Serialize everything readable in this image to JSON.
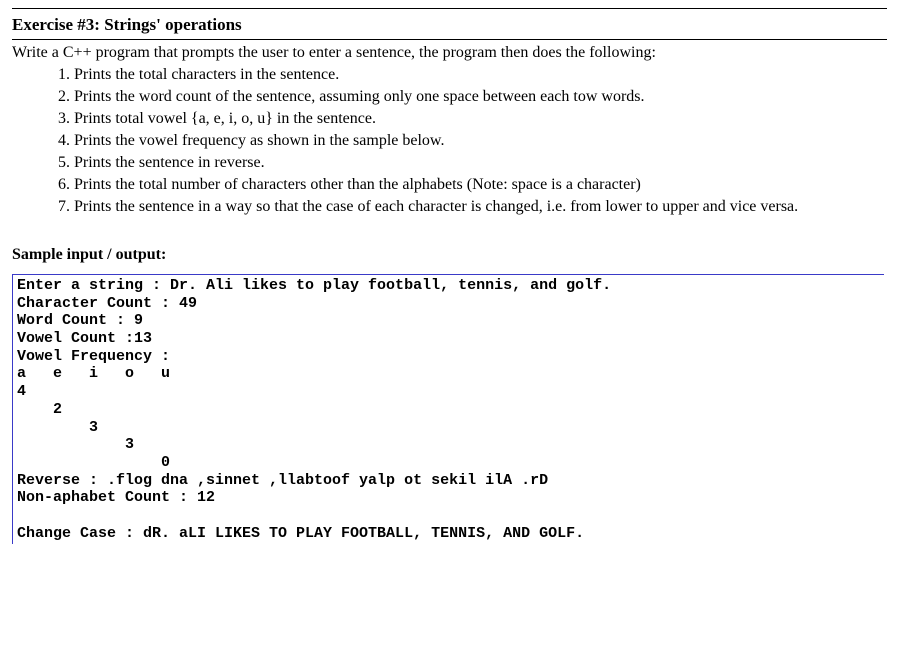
{
  "title": "Exercise #3: Strings' operations",
  "intro": "Write a C++ program that prompts the user to enter a sentence, the program then does the following:",
  "items": [
    "Prints the total characters in the sentence.",
    "Prints the word count of the sentence, assuming only one space between each tow words.",
    "Prints total vowel {a, e, i, o, u} in the sentence.",
    "Prints the vowel frequency as shown in the sample below.",
    "Prints the sentence in reverse.",
    "Prints the total number of characters other than the alphabets (Note: space is a character)",
    "Prints the sentence in a way so that the case of each character is changed, i.e. from lower to upper and vice versa."
  ],
  "sample_heading": "Sample input / output:",
  "console": "Enter a string : Dr. Ali likes to play football, tennis, and golf.\nCharacter Count : 49\nWord Count : 9\nVowel Count :13\nVowel Frequency :\na   e   i   o   u\n4\n    2\n        3\n            3\n                0\nReverse : .flog dna ,sinnet ,llabtoof yalp ot sekil ilA .rD\nNon-aphabet Count : 12\n\nChange Case : dR. aLI LIKES TO PLAY FOOTBALL, TENNIS, AND GOLF."
}
